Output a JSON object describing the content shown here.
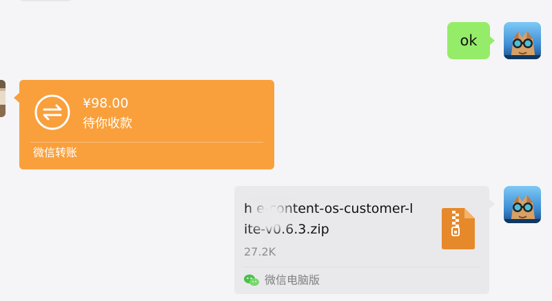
{
  "messages": {
    "text": {
      "content": "ok"
    },
    "transfer": {
      "amount": "¥98.00",
      "status": "待你收款",
      "footer": "微信转账",
      "color": "#f9a03c"
    },
    "file": {
      "name": "h    e-content-os-customer-lite-v0.6.3.zip",
      "size": "27.2K",
      "source": "微信电脑版",
      "icon": "zip-file-icon"
    }
  },
  "colors": {
    "background": "#f5f5f7",
    "outgoing_bubble": "#95ec69",
    "file_card": "#e9e9ec",
    "zip_icon": "#e6892a"
  }
}
